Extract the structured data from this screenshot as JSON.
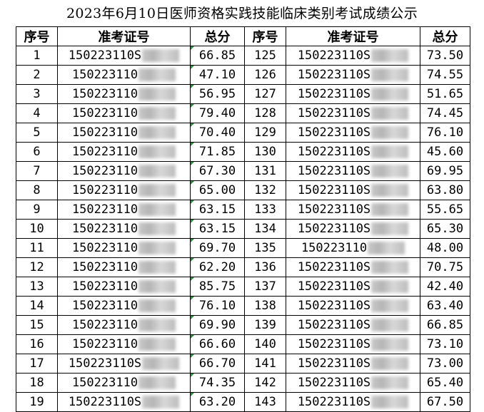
{
  "title": "2023年6月10日医师资格实践技能临床类别考试成绩公示",
  "headers": [
    "序号",
    "准考证号",
    "总分",
    "序号",
    "准考证号",
    "总分"
  ],
  "rows": [
    {
      "seq": "1",
      "id": "150223110S",
      "score": "66.85",
      "seq2": "125",
      "id2": "150223110S",
      "score2": "73.50"
    },
    {
      "seq": "2",
      "id": "150223110",
      "score": "47.10",
      "seq2": "126",
      "id2": "150223110S",
      "score2": "74.55"
    },
    {
      "seq": "3",
      "id": "150223110",
      "score": "56.95",
      "seq2": "127",
      "id2": "150223110S",
      "score2": "51.65"
    },
    {
      "seq": "4",
      "id": "150223110",
      "score": "79.40",
      "seq2": "128",
      "id2": "150223110S",
      "score2": "74.45"
    },
    {
      "seq": "5",
      "id": "150223110",
      "score": "70.40",
      "seq2": "129",
      "id2": "150223110S",
      "score2": "76.10"
    },
    {
      "seq": "6",
      "id": "150223110",
      "score": "71.85",
      "seq2": "130",
      "id2": "150223110S",
      "score2": "45.60"
    },
    {
      "seq": "7",
      "id": "150223110",
      "score": "67.30",
      "seq2": "131",
      "id2": "150223110S",
      "score2": "69.95"
    },
    {
      "seq": "8",
      "id": "150223110",
      "score": "65.00",
      "seq2": "132",
      "id2": "150223110S",
      "score2": "63.80"
    },
    {
      "seq": "9",
      "id": "150223110",
      "score": "63.15",
      "seq2": "133",
      "id2": "150223110S",
      "score2": "55.65"
    },
    {
      "seq": "10",
      "id": "150223110",
      "score": "63.15",
      "seq2": "134",
      "id2": "150223110S",
      "score2": "65.30"
    },
    {
      "seq": "11",
      "id": "150223110",
      "score": "69.70",
      "seq2": "135",
      "id2": "150223110",
      "score2": "48.00"
    },
    {
      "seq": "12",
      "id": "150223110",
      "score": "62.20",
      "seq2": "136",
      "id2": "150223110S",
      "score2": "70.75"
    },
    {
      "seq": "13",
      "id": "150223110",
      "score": "85.75",
      "seq2": "137",
      "id2": "150223110S",
      "score2": "42.40"
    },
    {
      "seq": "14",
      "id": "150223110",
      "score": "76.10",
      "seq2": "138",
      "id2": "150223110S",
      "score2": "63.40"
    },
    {
      "seq": "15",
      "id": "150223110",
      "score": "69.90",
      "seq2": "139",
      "id2": "150223110S",
      "score2": "66.85"
    },
    {
      "seq": "16",
      "id": "150223110",
      "score": "66.60",
      "seq2": "140",
      "id2": "150223110S",
      "score2": "73.10"
    },
    {
      "seq": "17",
      "id": "150223110S",
      "score": "66.70",
      "seq2": "141",
      "id2": "150223110S",
      "score2": "73.00"
    },
    {
      "seq": "18",
      "id": "150223110",
      "score": "74.35",
      "seq2": "142",
      "id2": "150223110S",
      "score2": "65.40"
    },
    {
      "seq": "19",
      "id": "150223110S",
      "score": "63.20",
      "seq2": "143",
      "id2": "150223110S",
      "score2": "67.50"
    }
  ]
}
